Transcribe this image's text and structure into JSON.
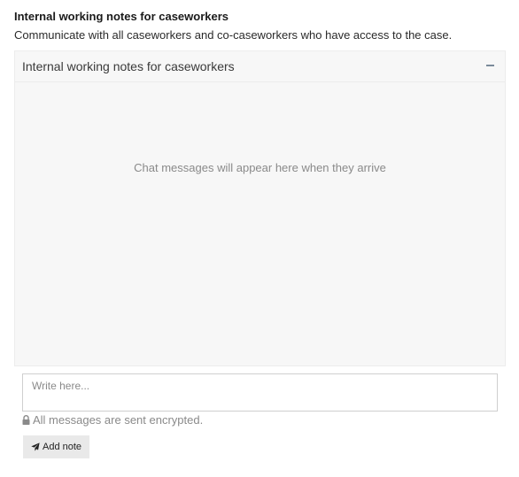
{
  "section": {
    "title": "Internal working notes for caseworkers",
    "description": "Communicate with all caseworkers and co-caseworkers who have access to the case."
  },
  "panel": {
    "title": "Internal working notes for caseworkers",
    "collapse_icon": "minus-icon",
    "empty_message": "Chat messages will appear here when they arrive"
  },
  "composer": {
    "placeholder": "Write here...",
    "value": "",
    "encryption_notice": "All messages are sent encrypted.",
    "encryption_icon": "lock-icon",
    "add_note_label": "Add note",
    "add_note_icon": "send-icon"
  }
}
